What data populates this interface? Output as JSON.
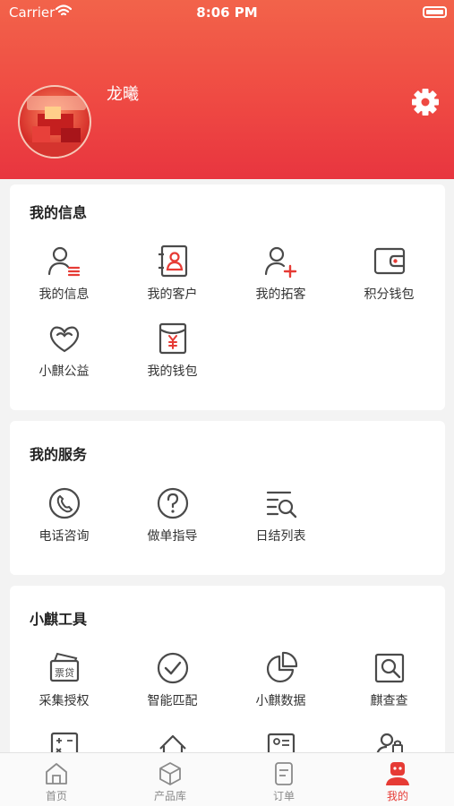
{
  "status_bar": {
    "carrier": "Carrier",
    "time": "8:06 PM"
  },
  "profile": {
    "name": "龙曦"
  },
  "sections": [
    {
      "title": "我的信息",
      "items": [
        {
          "label": "我的信息",
          "icon": "user-list-icon"
        },
        {
          "label": "我的客户",
          "icon": "contact-book-icon"
        },
        {
          "label": "我的拓客",
          "icon": "add-user-icon"
        },
        {
          "label": "积分钱包",
          "icon": "wallet-icon"
        },
        {
          "label": "小麒公益",
          "icon": "heart-charity-icon"
        },
        {
          "label": "我的钱包",
          "icon": "yuan-envelope-icon"
        }
      ]
    },
    {
      "title": "我的服务",
      "items": [
        {
          "label": "电话咨询",
          "icon": "phone-icon"
        },
        {
          "label": "做单指导",
          "icon": "question-icon"
        },
        {
          "label": "日结列表",
          "icon": "list-search-icon"
        }
      ]
    },
    {
      "title": "小麒工具",
      "items": [
        {
          "label": "采集授权",
          "icon": "ticket-loan-icon"
        },
        {
          "label": "智能匹配",
          "icon": "check-circle-icon"
        },
        {
          "label": "小麒数据",
          "icon": "pie-chart-icon"
        },
        {
          "label": "麒查查",
          "icon": "search-doc-icon"
        }
      ]
    }
  ],
  "tabbar": [
    {
      "label": "首页",
      "icon": "home-icon",
      "active": false
    },
    {
      "label": "产品库",
      "icon": "box-icon",
      "active": false
    },
    {
      "label": "订单",
      "icon": "order-icon",
      "active": false
    },
    {
      "label": "我的",
      "icon": "profile-icon",
      "active": true
    }
  ],
  "colors": {
    "accent": "#e63b35",
    "icon": "#4a4a4a"
  }
}
